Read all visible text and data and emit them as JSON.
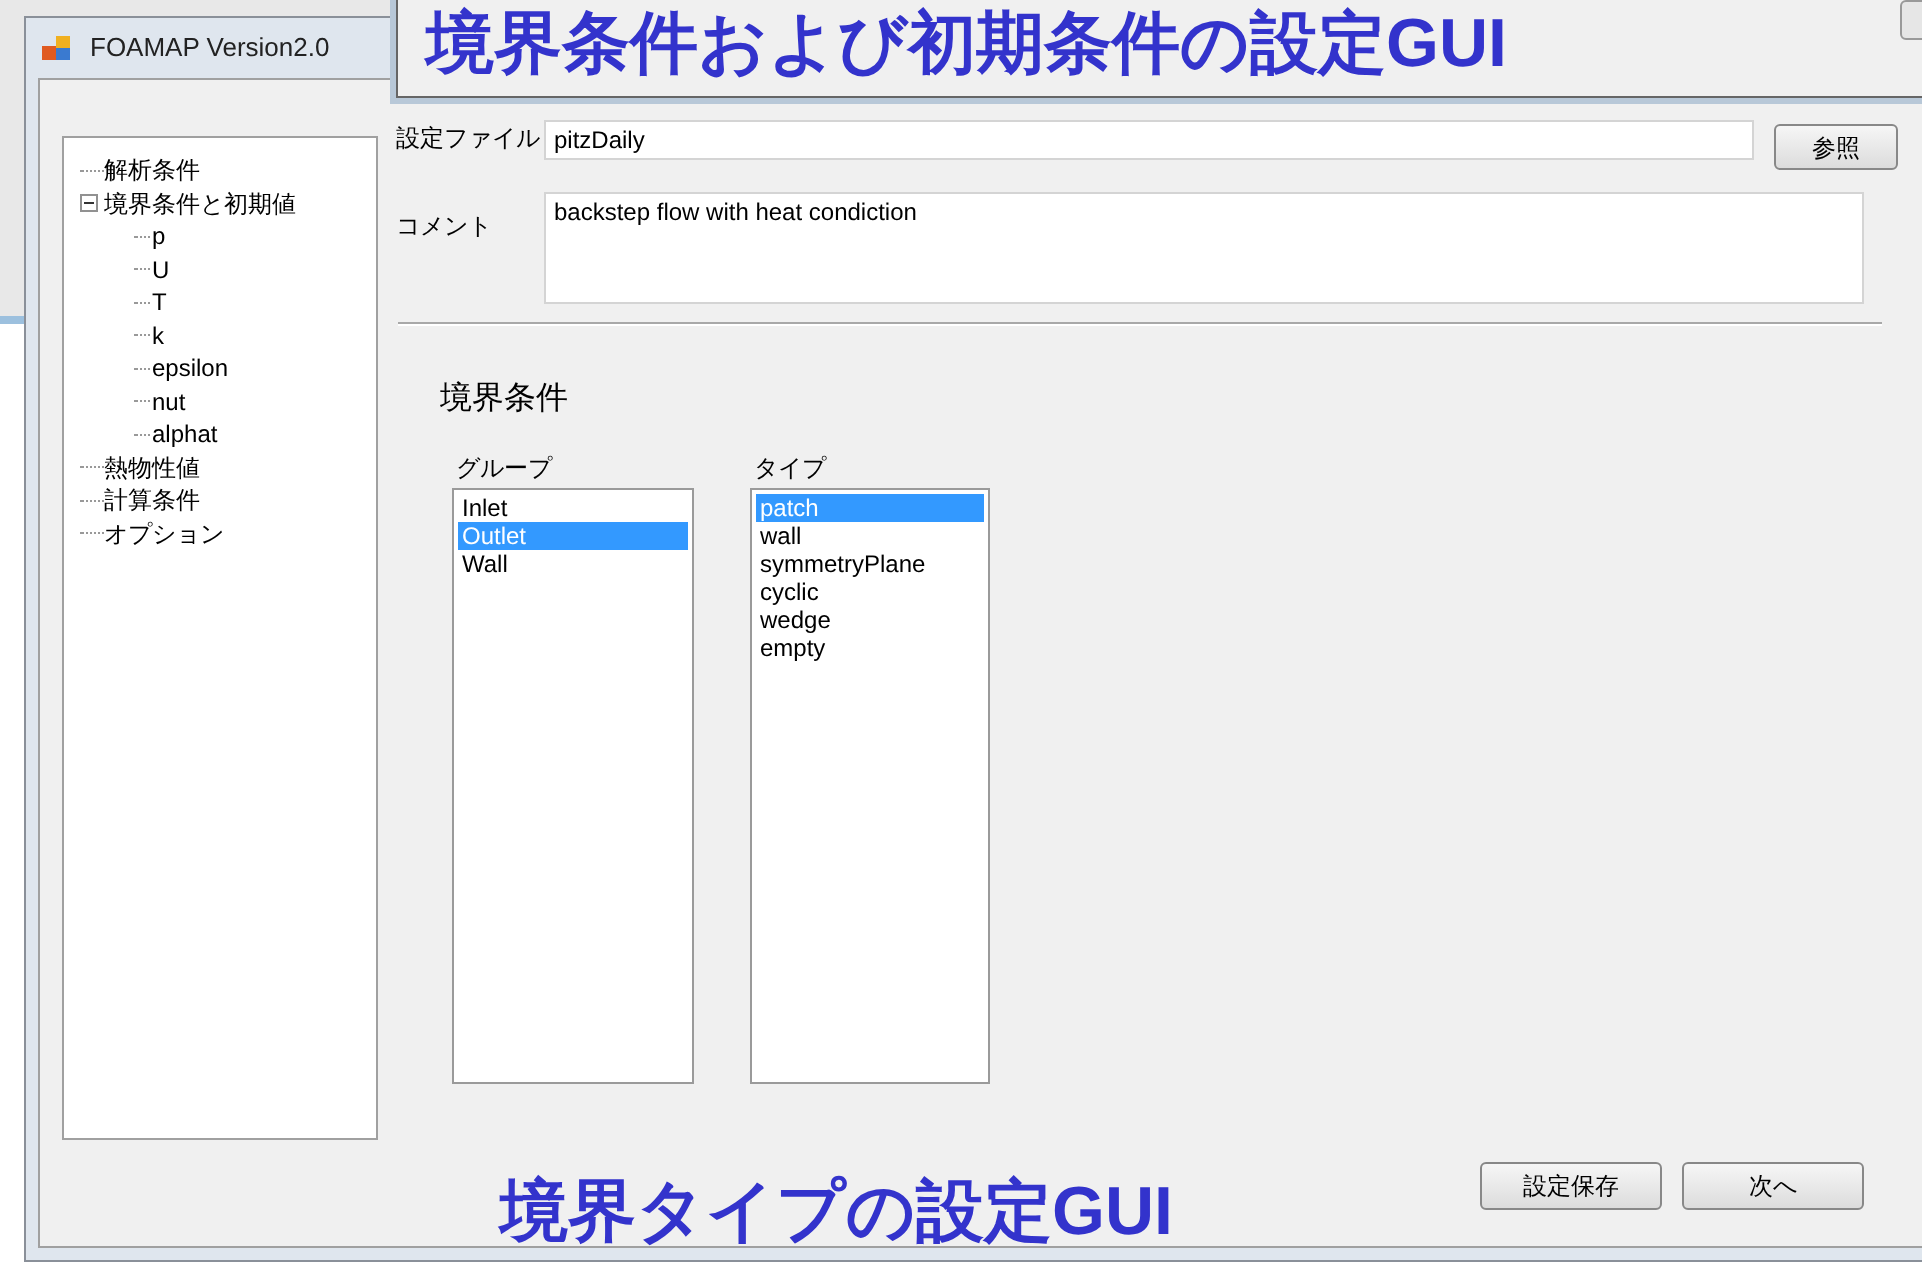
{
  "window": {
    "title": "FOAMAP Version2.0"
  },
  "caption_top": "境界条件および初期条件の設定GUI",
  "caption_bottom": "境界タイプの設定GUI",
  "tree": [
    {
      "label": "解析条件"
    },
    {
      "label": "境界条件と初期値",
      "expanded": true,
      "children": [
        {
          "label": "p"
        },
        {
          "label": "U"
        },
        {
          "label": "T"
        },
        {
          "label": "k"
        },
        {
          "label": "epsilon"
        },
        {
          "label": "nut"
        },
        {
          "label": "alphat"
        }
      ]
    },
    {
      "label": "熱物性値"
    },
    {
      "label": "計算条件"
    },
    {
      "label": "オプション"
    }
  ],
  "settings_file": {
    "label": "設定ファイル",
    "value": "pitzDaily",
    "browse_button": "参照"
  },
  "comment": {
    "label": "コメント",
    "value": "backstep flow with heat condiction"
  },
  "section_title": "境界条件",
  "group_list": {
    "label": "グループ",
    "items": [
      {
        "label": "Inlet",
        "selected": false
      },
      {
        "label": "Outlet",
        "selected": true
      },
      {
        "label": "Wall",
        "selected": false
      }
    ]
  },
  "type_list": {
    "label": "タイプ",
    "items": [
      {
        "label": "patch",
        "selected": true
      },
      {
        "label": "wall",
        "selected": false
      },
      {
        "label": "symmetryPlane",
        "selected": false
      },
      {
        "label": "cyclic",
        "selected": false
      },
      {
        "label": "wedge",
        "selected": false
      },
      {
        "label": "empty",
        "selected": false
      }
    ]
  },
  "buttons": [
    "設定保存",
    "次へ"
  ]
}
